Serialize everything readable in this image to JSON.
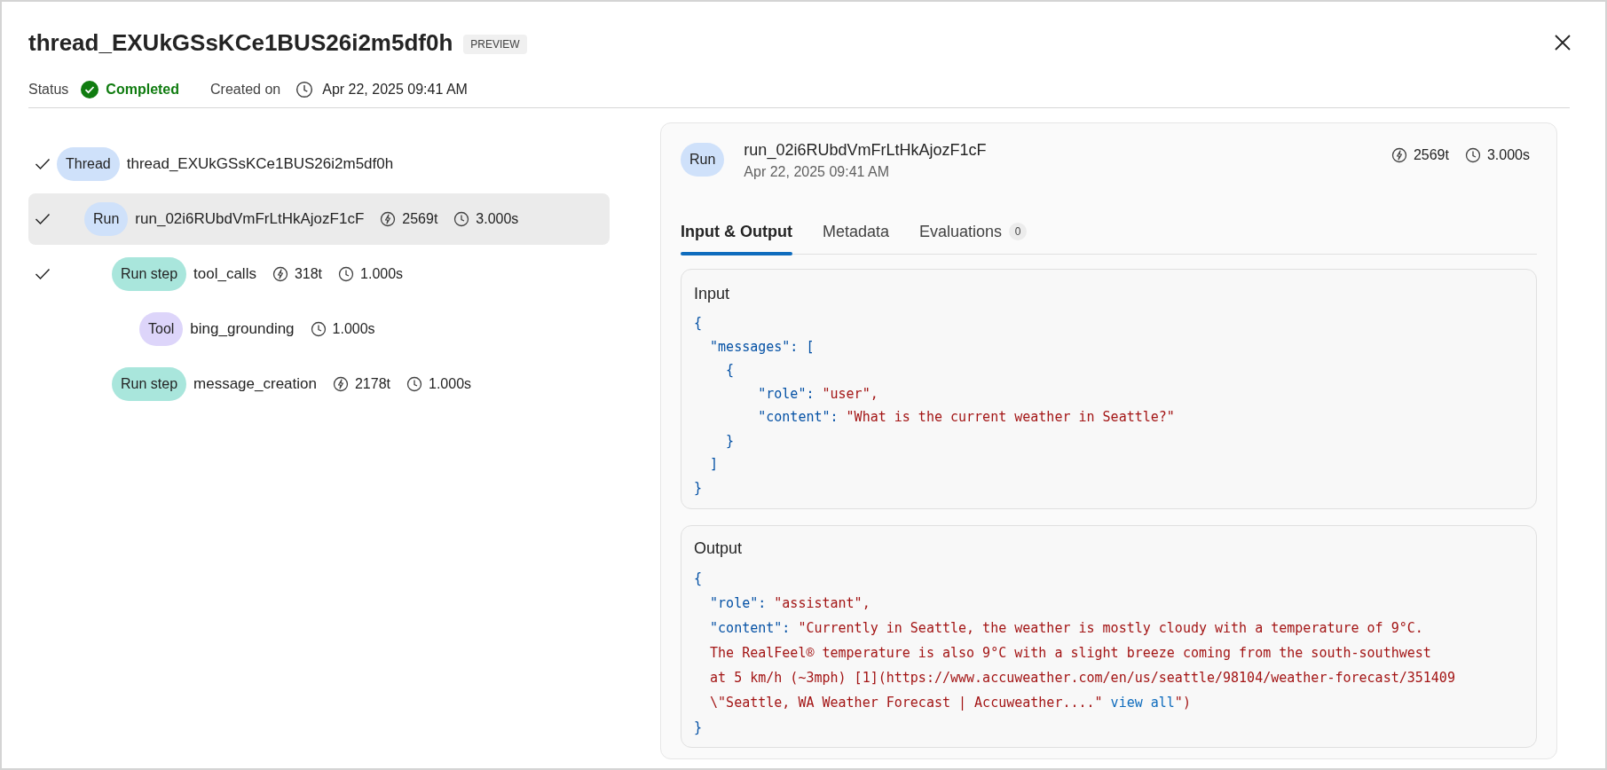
{
  "window": {
    "title": "thread_EXUkGSsKCe1BUS26i2m5df0h",
    "badge": "PREVIEW"
  },
  "status": {
    "label": "Status",
    "value": "Completed",
    "created_label": "Created on",
    "created_value": "Apr 22, 2025 09:41 AM"
  },
  "tree": [
    {
      "kind": "thread",
      "tag": "Thread",
      "name": "thread_EXUkGSsKCe1BUS26i2m5df0h",
      "completed": true,
      "selected": false,
      "children": [
        {
          "kind": "run",
          "tag": "Run",
          "name": "run_02i6RUbdVmFrLtHkAjozF1cF",
          "tokens": "2569t",
          "duration": "3.000s",
          "completed": true,
          "selected": true,
          "children": [
            {
              "kind": "run_step",
              "tag": "Run step",
              "name": "tool_calls",
              "tokens": "318t",
              "duration": "1.000s",
              "completed": true,
              "selected": false,
              "children": [
                {
                  "kind": "tool",
                  "tag": "Tool",
                  "name": "bing_grounding",
                  "duration": "1.000s",
                  "completed": false,
                  "selected": false
                }
              ]
            },
            {
              "kind": "run_step",
              "tag": "Run step",
              "name": "message_creation",
              "tokens": "2178t",
              "duration": "1.000s",
              "completed": false,
              "selected": false
            }
          ]
        }
      ]
    }
  ],
  "detail": {
    "tag": "Run",
    "name": "run_02i6RUbdVmFrLtHkAjozF1cF",
    "date": "Apr 22, 2025 09:41 AM",
    "tokens": "2569t",
    "duration": "3.000s",
    "tabs": [
      {
        "label": "Input & Output",
        "selected": true
      },
      {
        "label": "Metadata",
        "selected": false
      },
      {
        "label": "Evaluations",
        "count": "0",
        "selected": false
      }
    ],
    "sections": [
      {
        "title": "Input",
        "lines": [
          [
            {
              "kind": "punct",
              "text": "{"
            }
          ],
          [
            {
              "kind": "key",
              "text": "  \"messages\": ["
            }
          ],
          [
            {
              "kind": "punct",
              "text": "    {"
            }
          ],
          [
            {
              "kind": "key",
              "text": "        \"role\": "
            },
            {
              "kind": "string",
              "text": "\"user\","
            }
          ],
          [
            {
              "kind": "key",
              "text": "        \"content\": "
            },
            {
              "kind": "string",
              "text": "\"What is the current weather in Seattle?\""
            }
          ],
          [
            {
              "kind": "punct",
              "text": "    }"
            }
          ],
          [
            {
              "kind": "punct",
              "text": "  ]"
            }
          ],
          [
            {
              "kind": "punct",
              "text": "}"
            }
          ]
        ]
      },
      {
        "title": "Output",
        "lines": [
          [
            {
              "kind": "punct",
              "text": "{"
            }
          ],
          [
            {
              "kind": "key",
              "text": "  \"role\": "
            },
            {
              "kind": "string",
              "text": "\"assistant\","
            }
          ],
          [
            {
              "kind": "key",
              "text": "  \"content\": "
            },
            {
              "kind": "string",
              "text": "\"Currently in Seattle, the weather is mostly cloudy with a temperature of 9°C."
            }
          ],
          [
            {
              "kind": "string",
              "text": "  The RealFeel® temperature is also 9°C with a slight breeze coming from the south-southwest"
            }
          ],
          [
            {
              "kind": "string",
              "text": "  at 5 km/h (~3mph) [1](https://www.accuweather.com/en/us/seattle/98104/weather-forecast/351409"
            }
          ],
          [
            {
              "kind": "string",
              "text": "  \\\"Seattle, WA Weather Forecast | Accuweather....\""
            },
            {
              "kind": "link",
              "text": " view all"
            },
            {
              "kind": "string",
              "text": "\")"
            }
          ],
          [
            {
              "kind": "punct",
              "text": "}"
            }
          ]
        ]
      }
    ]
  }
}
